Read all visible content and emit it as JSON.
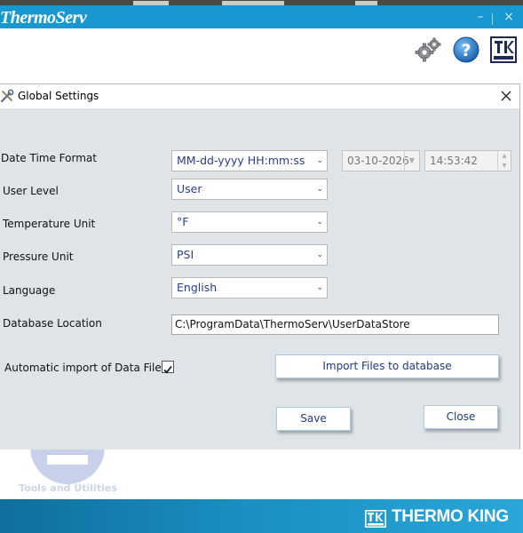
{
  "app": {
    "title": "ThermoServ",
    "window_controls": {
      "minimize": "–",
      "close": "×"
    },
    "toolbar_icons": [
      "gear-icon",
      "help-icon",
      "thermo-king-icon"
    ]
  },
  "dialog": {
    "title": "Global Settings",
    "close_symbol": "×",
    "fields": {
      "datetime": {
        "label": "Date Time Format",
        "format": "MM-dd-yyyy HH:mm:ss",
        "date": "03-10-2026",
        "time": "14:53:42"
      },
      "user_level": {
        "label": "User Level",
        "value": "User"
      },
      "temperature": {
        "label": "Temperature Unit",
        "value": "°F"
      },
      "pressure": {
        "label": "Pressure Unit",
        "value": "PSI"
      },
      "language": {
        "label": "Language",
        "value": "English"
      },
      "database": {
        "label": "Database Location",
        "value": "C:\\ProgramData\\ThermoServ\\UserDataStore"
      },
      "auto_import": {
        "label": "Automatic import of Data Files",
        "checked": true
      }
    },
    "buttons": {
      "import": "Import Files to database",
      "save": "Save",
      "close": "Close"
    }
  },
  "background": {
    "tools_label": "Tools and Utilities"
  },
  "footer": {
    "brand": "THERMO KING"
  },
  "colors": {
    "titlebar": "#1798d0",
    "dialog_body": "#dee4e8",
    "combo_text": "#2c3d8f",
    "button_text": "#1f3a78",
    "footer": "#1a8ec0"
  }
}
